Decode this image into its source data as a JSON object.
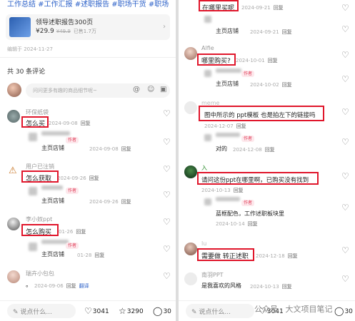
{
  "left": {
    "tags": "工作总结 #工作汇报 #述职报告 #职场干货 #职场",
    "product": {
      "title": "领导述职报告300页",
      "price": "¥29.9",
      "old_price": "¥49.9",
      "sold": "已售1.7万"
    },
    "edited": "编辑于 2024-11-27",
    "comment_count": "共 30 条评论",
    "input_placeholder": "问问更多有趣的商品细节呢~",
    "comments": [
      {
        "user": "环保纸袋",
        "text": "怎么买",
        "date": "2024-09-08",
        "reply": "回复",
        "reply_item": {
          "user": "主页店铺",
          "badge": "作者",
          "date": "2024-09-08",
          "reply": "回复"
        }
      },
      {
        "user": "用户已注销",
        "text": "怎么获取",
        "date": "2024-09-26",
        "reply": "回复",
        "reply_item": {
          "user": "主页店铺",
          "badge": "作者",
          "date": "2024-09-26",
          "reply": "回复"
        }
      },
      {
        "user": "李小奴ppt",
        "text": "怎么购买",
        "date": "01-26",
        "reply": "回复",
        "reply_item": {
          "user": "主页店铺",
          "badge": "作者",
          "date": "01-28",
          "reply": "回复"
        }
      },
      {
        "user": "瑞卉小包包",
        "text": "。",
        "date": "2024-09-06",
        "reply": "回复",
        "translate": "翻译"
      }
    ],
    "bottom": {
      "say": "说点什么...",
      "likes": "3041",
      "stars": "3290",
      "comments": "30"
    }
  },
  "right": {
    "comments": [
      {
        "text": "在哪里买呢",
        "date": "2024-09-21",
        "reply": "回复",
        "reply_item": {
          "user": "主页店铺",
          "date": "2024-09-21",
          "reply": "回复"
        }
      },
      {
        "user": "Alfie",
        "text": "哪里购买?",
        "date": "2024-10-01",
        "reply": "回复",
        "reply_item": {
          "badge": "作者",
          "user": "主页店铺",
          "date": "2024-10-02",
          "reply": "回复"
        }
      },
      {
        "user": "meme",
        "text": "图中所示的 ppt模板 也是拍左下的链接吗",
        "date": "2024-12-07",
        "reply": "回复",
        "reply_item": {
          "badge": "作者",
          "text": "对的",
          "date": "2024-12-08",
          "reply": "回复"
        }
      },
      {
        "user": "入",
        "text": "请问这份ppt在哪里啊，已购买没有找到",
        "date": "2024-10-13",
        "reply": "回复",
        "reply_item": {
          "badge": "作者",
          "text": "蓝框配色，工作述职板块里",
          "date": "2024-10-14",
          "reply": "回复"
        }
      },
      {
        "user": "lu",
        "text": "需要做 转正述职",
        "date": "2024-12-18",
        "reply": "回复"
      },
      {
        "user": "南羽PPT",
        "text": "是我喜欢的风格",
        "date": "2024-10-13",
        "reply": "回复"
      }
    ],
    "bottom": {
      "say": "说点什么...",
      "likes": "3041",
      "watermark": "公众号 · 大文项目笔记",
      "comments": "30"
    }
  },
  "colors": {
    "highlight": "#e0162b",
    "author_badge": "#e0405a",
    "tag_link": "#2f63c9"
  },
  "icons": [
    "heart-icon",
    "star-icon",
    "comment-icon",
    "at-icon",
    "emoji-icon",
    "image-icon",
    "pencil-icon",
    "chevron-right-icon"
  ]
}
